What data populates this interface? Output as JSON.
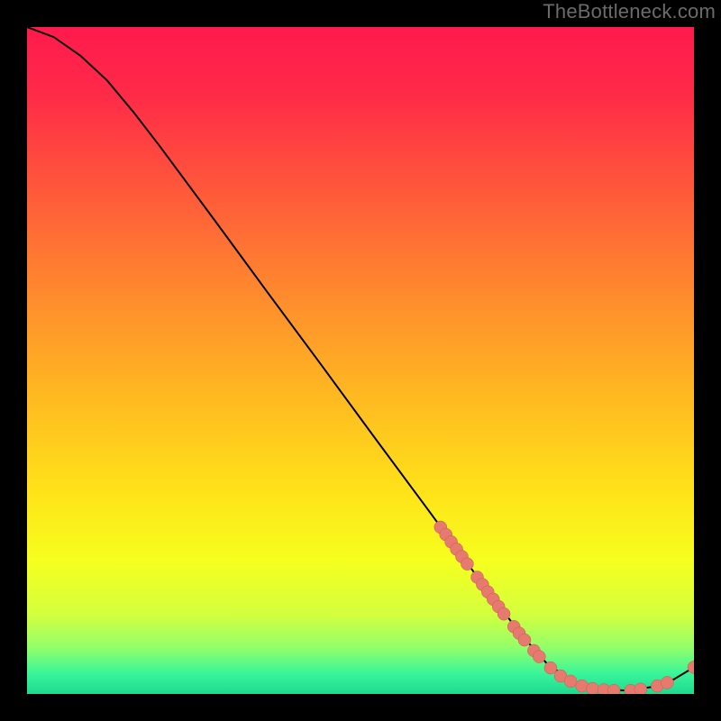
{
  "watermark": "TheBottleneck.com",
  "colors": {
    "background": "#000000",
    "watermark_text": "#6b6b6b",
    "gradient_stops": [
      {
        "offset": 0.0,
        "color": "#ff1a4d"
      },
      {
        "offset": 0.1,
        "color": "#ff2a48"
      },
      {
        "offset": 0.25,
        "color": "#ff5a3a"
      },
      {
        "offset": 0.4,
        "color": "#ff8a2e"
      },
      {
        "offset": 0.55,
        "color": "#ffb821"
      },
      {
        "offset": 0.7,
        "color": "#ffe319"
      },
      {
        "offset": 0.8,
        "color": "#f6ff1e"
      },
      {
        "offset": 0.88,
        "color": "#d4ff3d"
      },
      {
        "offset": 0.93,
        "color": "#93ff6a"
      },
      {
        "offset": 0.97,
        "color": "#38f59a"
      },
      {
        "offset": 1.0,
        "color": "#1ed98f"
      }
    ],
    "curve": "#000000",
    "marker_fill": "#e67a6e",
    "marker_stroke": "#c75a50"
  },
  "chart_data": {
    "type": "line",
    "title": "",
    "xlabel": "",
    "ylabel": "",
    "xlim": [
      0,
      100
    ],
    "ylim": [
      0,
      100
    ],
    "curve": [
      {
        "x": 0.0,
        "y": 100.0
      },
      {
        "x": 4.0,
        "y": 98.5
      },
      {
        "x": 8.0,
        "y": 95.7
      },
      {
        "x": 12.0,
        "y": 92.0
      },
      {
        "x": 16.0,
        "y": 87.2
      },
      {
        "x": 20.0,
        "y": 82.0
      },
      {
        "x": 28.0,
        "y": 71.2
      },
      {
        "x": 36.0,
        "y": 60.3
      },
      {
        "x": 44.0,
        "y": 49.5
      },
      {
        "x": 52.0,
        "y": 38.6
      },
      {
        "x": 60.0,
        "y": 27.8
      },
      {
        "x": 68.0,
        "y": 16.9
      },
      {
        "x": 74.0,
        "y": 9.0
      },
      {
        "x": 78.0,
        "y": 4.5
      },
      {
        "x": 82.0,
        "y": 1.8
      },
      {
        "x": 86.0,
        "y": 0.7
      },
      {
        "x": 90.0,
        "y": 0.5
      },
      {
        "x": 94.0,
        "y": 1.1
      },
      {
        "x": 97.0,
        "y": 2.2
      },
      {
        "x": 100.0,
        "y": 4.0
      }
    ],
    "markers": [
      {
        "x": 62.0,
        "y": 25.0
      },
      {
        "x": 62.8,
        "y": 23.9
      },
      {
        "x": 63.6,
        "y": 22.8
      },
      {
        "x": 64.4,
        "y": 21.7
      },
      {
        "x": 65.2,
        "y": 20.6
      },
      {
        "x": 66.0,
        "y": 19.5
      },
      {
        "x": 67.5,
        "y": 17.5
      },
      {
        "x": 68.3,
        "y": 16.4
      },
      {
        "x": 69.1,
        "y": 15.3
      },
      {
        "x": 69.9,
        "y": 14.2
      },
      {
        "x": 70.7,
        "y": 13.1
      },
      {
        "x": 71.5,
        "y": 12.0
      },
      {
        "x": 73.0,
        "y": 10.1
      },
      {
        "x": 73.8,
        "y": 9.1
      },
      {
        "x": 74.6,
        "y": 8.1
      },
      {
        "x": 76.0,
        "y": 6.5
      },
      {
        "x": 76.8,
        "y": 5.6
      },
      {
        "x": 78.5,
        "y": 3.9
      },
      {
        "x": 80.0,
        "y": 2.7
      },
      {
        "x": 81.5,
        "y": 1.9
      },
      {
        "x": 83.2,
        "y": 1.2
      },
      {
        "x": 84.8,
        "y": 0.8
      },
      {
        "x": 86.5,
        "y": 0.6
      },
      {
        "x": 88.0,
        "y": 0.5
      },
      {
        "x": 90.5,
        "y": 0.5
      },
      {
        "x": 92.0,
        "y": 0.7
      },
      {
        "x": 94.5,
        "y": 1.2
      },
      {
        "x": 96.0,
        "y": 1.7
      },
      {
        "x": 100.0,
        "y": 4.0
      }
    ]
  }
}
